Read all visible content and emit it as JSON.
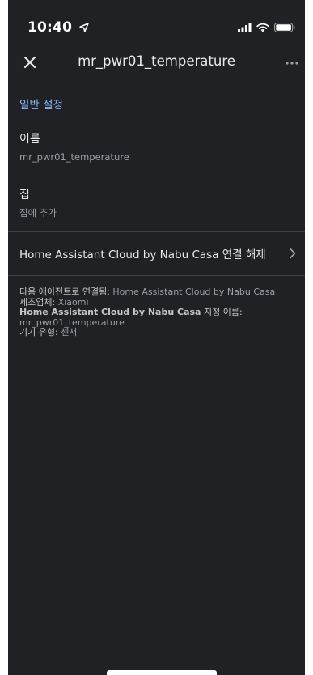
{
  "status_bar": {
    "time": "10:40"
  },
  "header": {
    "title": "mr_pwr01_temperature"
  },
  "section": {
    "title": "일반 설정"
  },
  "name_field": {
    "label": "이름",
    "value": "mr_pwr01_temperature"
  },
  "home_field": {
    "label": "집",
    "value": "집에 추가"
  },
  "unlink": {
    "label": "Home Assistant Cloud by Nabu Casa 연결 해제"
  },
  "device_info": {
    "connected_label": "다음 에이전트로 연결됨:",
    "connected_value": "Home Assistant Cloud by Nabu Casa",
    "manufacturer_label": "제조업체:",
    "manufacturer_value": "Xiaomi",
    "assigned_name_bold": "Home Assistant Cloud by Nabu Casa",
    "assigned_name_label": "지정 이름:",
    "assigned_name_value": "mr_pwr01_temperature",
    "device_type_label": "기기 유형:",
    "device_type_value": "센서"
  },
  "icons": {
    "close": "close-icon",
    "more": "more-horizontal-icon",
    "chevron": "chevron-right-icon",
    "location": "location-arrow-icon",
    "signal": "signal-bars-icon",
    "wifi": "wifi-icon",
    "battery": "battery-icon"
  },
  "colors": {
    "background": "#202124",
    "accent": "#8ab4f8",
    "primary_text": "#e8eaed",
    "secondary_text": "#9aa0a6",
    "divider": "#3c4043"
  }
}
